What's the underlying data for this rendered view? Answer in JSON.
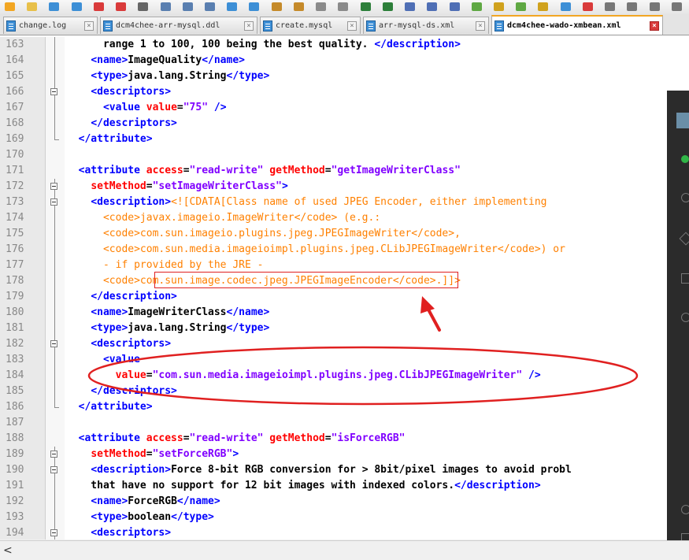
{
  "toolbar": {
    "icons": [
      "new-file-icon",
      "open-folder-icon",
      "save-icon",
      "save-all-icon",
      "close-icon",
      "close-all-icon",
      "print-icon",
      "cut-icon",
      "copy-icon",
      "paste-icon",
      "undo-icon",
      "redo-icon",
      "find-icon",
      "replace-icon",
      "zoom-in-icon",
      "zoom-out-icon",
      "sync-v-icon",
      "sync-h-icon",
      "word-wrap-icon",
      "show-all-icon",
      "indent-guide-icon",
      "lang-icon",
      "doc-map-icon",
      "function-list-icon",
      "folder-workspace-icon",
      "monitor-icon",
      "record-icon",
      "stop-icon",
      "play-icon",
      "play-multi-icon",
      "save-macro-icon"
    ]
  },
  "tabs": [
    {
      "label": "change.log",
      "active": false
    },
    {
      "label": "dcm4chee-arr-mysql.ddl",
      "active": false
    },
    {
      "label": "create.mysql",
      "active": false
    },
    {
      "label": "arr-mysql-ds.xml",
      "active": false
    },
    {
      "label": "dcm4chee-wado-xmbean.xml",
      "active": true
    }
  ],
  "editor": {
    "lines": [
      {
        "n": "163",
        "fold": "line",
        "segs": [
          [
            "text",
            "      range 1 to 100, 100 being the best quality. "
          ],
          [
            "tag",
            "</description>"
          ]
        ]
      },
      {
        "n": "164",
        "fold": "line",
        "segs": [
          [
            "text",
            "    "
          ],
          [
            "tag",
            "<name>"
          ],
          [
            "text",
            "ImageQuality"
          ],
          [
            "tag",
            "</name>"
          ]
        ]
      },
      {
        "n": "165",
        "fold": "line",
        "segs": [
          [
            "text",
            "    "
          ],
          [
            "tag",
            "<type>"
          ],
          [
            "text",
            "java.lang.String"
          ],
          [
            "tag",
            "</type>"
          ]
        ]
      },
      {
        "n": "166",
        "fold": "box",
        "segs": [
          [
            "text",
            "    "
          ],
          [
            "tag",
            "<descriptors>"
          ]
        ]
      },
      {
        "n": "167",
        "fold": "line",
        "segs": [
          [
            "text",
            "      "
          ],
          [
            "tag",
            "<value "
          ],
          [
            "attr",
            "value"
          ],
          [
            "text",
            "="
          ],
          [
            "val",
            "\"75\""
          ],
          [
            "tag",
            " />"
          ]
        ]
      },
      {
        "n": "168",
        "fold": "line",
        "segs": [
          [
            "text",
            "    "
          ],
          [
            "tag",
            "</descriptors>"
          ]
        ]
      },
      {
        "n": "169",
        "fold": "end",
        "segs": [
          [
            "text",
            "  "
          ],
          [
            "tag",
            "</attribute>"
          ]
        ]
      },
      {
        "n": "170",
        "fold": "none",
        "segs": []
      },
      {
        "n": "171",
        "fold": "none",
        "segs": [
          [
            "text",
            "  "
          ],
          [
            "tag",
            "<attribute "
          ],
          [
            "attr",
            "access"
          ],
          [
            "text",
            "="
          ],
          [
            "val",
            "\"read-write\""
          ],
          [
            "text",
            " "
          ],
          [
            "attr",
            "getMethod"
          ],
          [
            "text",
            "="
          ],
          [
            "val",
            "\"getImageWriterClass\""
          ]
        ]
      },
      {
        "n": "172",
        "fold": "box",
        "segs": [
          [
            "text",
            "    "
          ],
          [
            "attr",
            "setMethod"
          ],
          [
            "text",
            "="
          ],
          [
            "val",
            "\"setImageWriterClass\""
          ],
          [
            "tag",
            ">"
          ]
        ]
      },
      {
        "n": "173",
        "fold": "box",
        "segs": [
          [
            "text",
            "    "
          ],
          [
            "tag",
            "<description>"
          ],
          [
            "cdata",
            "<![CDATA[Class name of used JPEG Encoder, either implementing"
          ]
        ]
      },
      {
        "n": "174",
        "fold": "line",
        "segs": [
          [
            "cdata",
            "      <code>javax.imageio.ImageWriter</code> (e.g.:"
          ]
        ]
      },
      {
        "n": "175",
        "fold": "line",
        "segs": [
          [
            "cdata",
            "      <code>com.sun.imageio.plugins.jpeg.JPEGImageWriter</code>,"
          ]
        ]
      },
      {
        "n": "176",
        "fold": "line",
        "segs": [
          [
            "cdata",
            "      <code>com.sun.media.imageioimpl.plugins.jpeg.CLibJPEGImageWriter</code>) or"
          ]
        ]
      },
      {
        "n": "177",
        "fold": "line",
        "segs": [
          [
            "cdata",
            "      - if provided by the JRE -"
          ]
        ]
      },
      {
        "n": "178",
        "fold": "line",
        "segs": [
          [
            "cdata",
            "      <code>com.sun.image.codec.jpeg.JPEGImageEncoder</code>.]]>"
          ]
        ]
      },
      {
        "n": "179",
        "fold": "line",
        "segs": [
          [
            "text",
            "    "
          ],
          [
            "tag",
            "</description>"
          ]
        ]
      },
      {
        "n": "180",
        "fold": "line",
        "segs": [
          [
            "text",
            "    "
          ],
          [
            "tag",
            "<name>"
          ],
          [
            "text",
            "ImageWriterClass"
          ],
          [
            "tag",
            "</name>"
          ]
        ]
      },
      {
        "n": "181",
        "fold": "line",
        "segs": [
          [
            "text",
            "    "
          ],
          [
            "tag",
            "<type>"
          ],
          [
            "text",
            "java.lang.String"
          ],
          [
            "tag",
            "</type>"
          ]
        ]
      },
      {
        "n": "182",
        "fold": "box",
        "segs": [
          [
            "text",
            "    "
          ],
          [
            "tag",
            "<descriptors>"
          ]
        ]
      },
      {
        "n": "183",
        "fold": "line",
        "segs": [
          [
            "text",
            "      "
          ],
          [
            "tag",
            "<value"
          ]
        ]
      },
      {
        "n": "184",
        "fold": "line",
        "segs": [
          [
            "text",
            "        "
          ],
          [
            "attr",
            "value"
          ],
          [
            "text",
            "="
          ],
          [
            "val",
            "\"com.sun.media.imageioimpl.plugins.jpeg.CLibJPEGImageWriter\""
          ],
          [
            "tag",
            " />"
          ]
        ]
      },
      {
        "n": "185",
        "fold": "line",
        "segs": [
          [
            "text",
            "    "
          ],
          [
            "tag",
            "</descriptors>"
          ]
        ]
      },
      {
        "n": "186",
        "fold": "end",
        "segs": [
          [
            "text",
            "  "
          ],
          [
            "tag",
            "</attribute>"
          ]
        ]
      },
      {
        "n": "187",
        "fold": "none",
        "segs": []
      },
      {
        "n": "188",
        "fold": "none",
        "segs": [
          [
            "text",
            "  "
          ],
          [
            "tag",
            "<attribute "
          ],
          [
            "attr",
            "access"
          ],
          [
            "text",
            "="
          ],
          [
            "val",
            "\"read-write\""
          ],
          [
            "text",
            " "
          ],
          [
            "attr",
            "getMethod"
          ],
          [
            "text",
            "="
          ],
          [
            "val",
            "\"isForceRGB\""
          ]
        ]
      },
      {
        "n": "189",
        "fold": "box",
        "segs": [
          [
            "text",
            "    "
          ],
          [
            "attr",
            "setMethod"
          ],
          [
            "text",
            "="
          ],
          [
            "val",
            "\"setForceRGB\""
          ],
          [
            "tag",
            ">"
          ]
        ]
      },
      {
        "n": "190",
        "fold": "box",
        "segs": [
          [
            "text",
            "    "
          ],
          [
            "tag",
            "<description>"
          ],
          [
            "text",
            "Force 8-bit RGB conversion for > 8bit/pixel images to avoid probl"
          ]
        ]
      },
      {
        "n": "191",
        "fold": "line",
        "segs": [
          [
            "text",
            "    that have no support for 12 bit images with indexed colors."
          ],
          [
            "tag",
            "</description>"
          ]
        ]
      },
      {
        "n": "192",
        "fold": "line",
        "segs": [
          [
            "text",
            "    "
          ],
          [
            "tag",
            "<name>"
          ],
          [
            "text",
            "ForceRGB"
          ],
          [
            "tag",
            "</name>"
          ]
        ]
      },
      {
        "n": "193",
        "fold": "line",
        "segs": [
          [
            "text",
            "    "
          ],
          [
            "tag",
            "<type>"
          ],
          [
            "text",
            "boolean"
          ],
          [
            "tag",
            "</type>"
          ]
        ]
      },
      {
        "n": "194",
        "fold": "box",
        "segs": [
          [
            "text",
            "    "
          ],
          [
            "tag",
            "<descriptors>"
          ]
        ]
      }
    ]
  },
  "colors": {
    "tag": "#0000ff",
    "attr": "#ff0000",
    "val": "#8000ff",
    "cdata": "#ff8000",
    "text": "#000000",
    "annotation": "#e02020",
    "active_tab_accent": "#f2a623"
  },
  "scrollbar": {
    "left_arrow": "<"
  }
}
